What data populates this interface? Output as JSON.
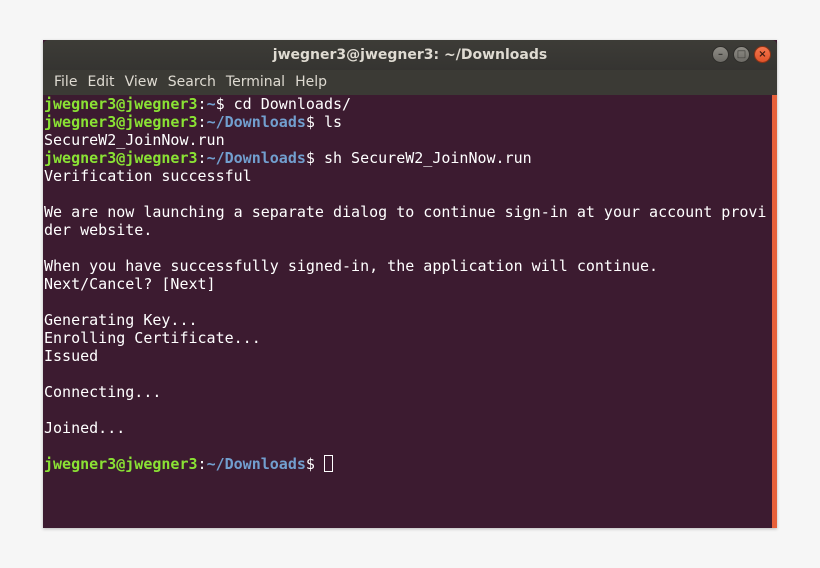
{
  "window": {
    "title": "jwegner3@jwegner3: ~/Downloads"
  },
  "menu": [
    "File",
    "Edit",
    "View",
    "Search",
    "Terminal",
    "Help"
  ],
  "prompt": {
    "user": "jwegner3@jwegner3",
    "colon": ":",
    "home_path": "~",
    "downloads_path": "~/Downloads",
    "symbol": "$"
  },
  "terminal": {
    "line1_cmd": " cd Downloads/",
    "line2_cmd": " ls",
    "line3": "SecureW2_JoinNow.run",
    "line4_cmd": " sh SecureW2_JoinNow.run",
    "line5": "Verification successful",
    "line7": "We are now launching a separate dialog to continue sign-in at your account provi",
    "line8": "der website.",
    "line10": "When you have successfully signed-in, the application will continue.",
    "line11": "Next/Cancel? [Next]",
    "line13": "Generating Key...",
    "line14": "Enrolling Certificate...",
    "line15": "Issued",
    "line17": "Connecting...",
    "line19": "Joined..."
  },
  "colors": {
    "terminal_bg": "#3c1b30",
    "prompt_user": "#8ae234",
    "prompt_path": "#729fcf",
    "accent": "#e7603a"
  },
  "icons": [
    "minimize-icon",
    "maximize-icon",
    "close-icon"
  ]
}
